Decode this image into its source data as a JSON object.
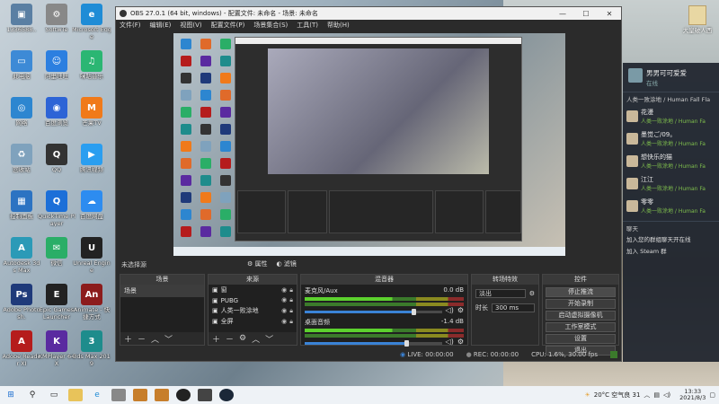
{
  "desktop_icons": [
    {
      "label": "1336588..",
      "color": "#5a7fa3",
      "glyph": "▣"
    },
    {
      "label": "SoftwTe",
      "color": "#888",
      "glyph": "⚙"
    },
    {
      "label": "Microsoft Edge",
      "color": "#1f8cd6",
      "glyph": "e"
    },
    {
      "label": "此电脑",
      "color": "#3d8ad6",
      "glyph": "▭"
    },
    {
      "label": "阿里旺旺",
      "color": "#2c7fe0",
      "glyph": "☺"
    },
    {
      "label": "咪咕音乐",
      "color": "#2bb673",
      "glyph": "♫"
    },
    {
      "label": "网络",
      "color": "#2d86d0",
      "glyph": "◎"
    },
    {
      "label": "百度浏览",
      "color": "#2d64d6",
      "glyph": "◉"
    },
    {
      "label": "芒果TV",
      "color": "#f07a1a",
      "glyph": "M"
    },
    {
      "label": "回收站",
      "color": "#7fa2bd",
      "glyph": "♻"
    },
    {
      "label": "QQ",
      "color": "#333",
      "glyph": "Q"
    },
    {
      "label": "腾讯视频",
      "color": "#2a9ef0",
      "glyph": "▶"
    },
    {
      "label": "控制面板",
      "color": "#2c73c2",
      "glyph": "▦"
    },
    {
      "label": "QuickTime Player",
      "color": "#1c6fd8",
      "glyph": "Q"
    },
    {
      "label": "百度网盘",
      "color": "#2d8cf0",
      "glyph": "☁"
    },
    {
      "label": "Autodesk 3ds Max",
      "color": "#2b9ab7",
      "glyph": "A"
    },
    {
      "label": "微信",
      "color": "#2aae67",
      "glyph": "✉"
    },
    {
      "label": "Unreal Engine",
      "color": "#222",
      "glyph": "U"
    },
    {
      "label": "Adobe Photosh.",
      "color": "#1f3a7a",
      "glyph": "Ps"
    },
    {
      "label": "Epic Games Launcher",
      "color": "#222",
      "glyph": "E"
    },
    {
      "label": "Animate - 快捷方式",
      "color": "#8c1c1c",
      "glyph": "An"
    },
    {
      "label": "Adobe Reader XI",
      "color": "#b51c1c",
      "glyph": "A"
    },
    {
      "label": "KMPlayer 64X",
      "color": "#5a2aa0",
      "glyph": "K"
    },
    {
      "label": "3ds Max 2019",
      "color": "#1e8c8c",
      "glyph": "3"
    }
  ],
  "top_right_icon": {
    "label": "大皇破人西"
  },
  "obs": {
    "title": "OBS 27.0.1 (64 bit, windows) - 配置文件: 未命名 - 场景: 未命名",
    "menu": [
      "文件(F)",
      "编辑(E)",
      "视图(V)",
      "配置文件(P)",
      "场景集合(S)",
      "工具(T)",
      "帮助(H)"
    ],
    "no_source_selected": "未选择源",
    "properties_btn": "属性",
    "filters_btn": "滤镜",
    "docks": {
      "scenes": {
        "title": "场景",
        "items": [
          "场景"
        ]
      },
      "sources": {
        "title": "来源",
        "items": [
          "窗",
          "PUBG",
          "人类一败涂地",
          "全屏"
        ]
      },
      "mixer": {
        "title": "混音器",
        "channels": [
          {
            "name": "麦克风/Aux",
            "db": "0.0 dB",
            "level": 0.8
          },
          {
            "name": "桌面音频",
            "db": "-1.4 dB",
            "level": 0.75
          }
        ]
      },
      "transitions": {
        "title": "转场特效",
        "type": "淡出",
        "duration_label": "时长",
        "duration": "300 ms"
      },
      "controls": {
        "title": "控件",
        "buttons": [
          "停止推流",
          "开始录制",
          "启动虚拟摄像机",
          "工作室模式",
          "设置",
          "退出"
        ]
      }
    },
    "status": {
      "live": "LIVE: 00:00:00",
      "rec": "REC: 00:00:00",
      "cpu": "CPU: 1.6%, 30.00 fps"
    }
  },
  "steam": {
    "username": "男男可可爱爱",
    "status": "在线",
    "game_label": "人类一败涂地 / Human Fall Fla",
    "friends": [
      {
        "name": "花漫",
        "game": "人类一败涂地 / Human Fa"
      },
      {
        "name": "墨觉ご/09。",
        "game": "人类一败涂地 / Human Fa"
      },
      {
        "name": "想快乐的猫",
        "game": "人类一败涂地 / Human Fa"
      },
      {
        "name": "江江",
        "game": "人类一败涂地 / Human Fa"
      },
      {
        "name": "零零",
        "game": "人类一败涂地 / Human Fa"
      }
    ],
    "chat_label": "聊天",
    "messages": [
      "加入您的群组聊天开在线",
      "加入 Steam 群"
    ]
  },
  "taskbar": {
    "weather": "20°C 空气良 31",
    "time": "13:33",
    "date": "2021/8/3"
  }
}
